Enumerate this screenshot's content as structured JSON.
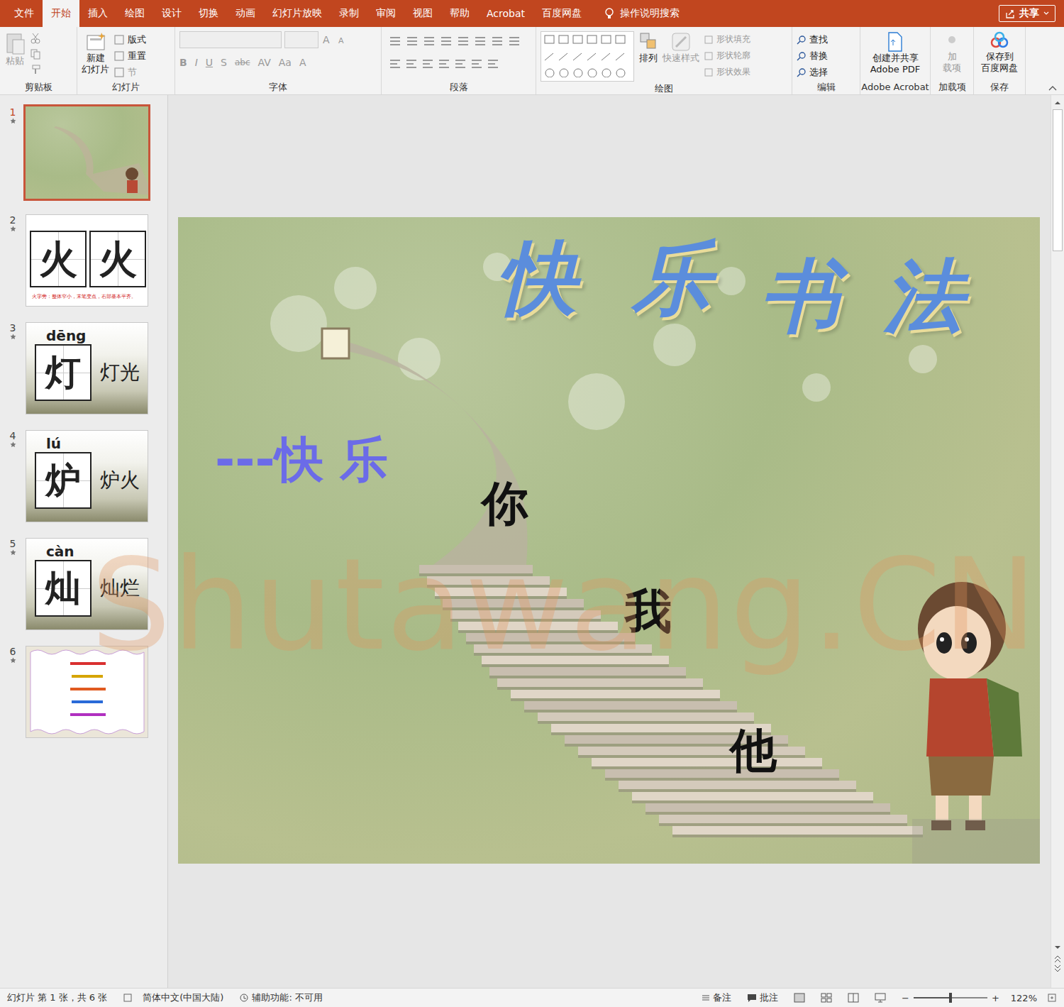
{
  "tabs": [
    {
      "label": "文件",
      "selected": false
    },
    {
      "label": "开始",
      "selected": true
    },
    {
      "label": "插入",
      "selected": false
    },
    {
      "label": "绘图",
      "selected": false
    },
    {
      "label": "设计",
      "selected": false
    },
    {
      "label": "切换",
      "selected": false
    },
    {
      "label": "动画",
      "selected": false
    },
    {
      "label": "幻灯片放映",
      "selected": false
    },
    {
      "label": "录制",
      "selected": false
    },
    {
      "label": "审阅",
      "selected": false
    },
    {
      "label": "视图",
      "selected": false
    },
    {
      "label": "帮助",
      "selected": false
    },
    {
      "label": "Acrobat",
      "selected": false
    },
    {
      "label": "百度网盘",
      "selected": false
    }
  ],
  "tell_me": "操作说明搜索",
  "share": "共享",
  "ribbon": {
    "clipboard": {
      "label": "剪贴板",
      "paste": {
        "label": "粘贴",
        "disabled": true
      }
    },
    "slides": {
      "label": "幻灯片",
      "new_slide": [
        "新建",
        "幻灯片"
      ],
      "layout": "版式",
      "reset": "重置",
      "section": {
        "label": "节",
        "disabled": true
      }
    },
    "font": {
      "label": "字体",
      "buttons": [
        "B",
        "I",
        "U",
        "S",
        "abc",
        "AV",
        "Aa",
        "A"
      ],
      "disabled": true
    },
    "paragraph": {
      "label": "段落"
    },
    "drawing": {
      "label": "绘图",
      "arrange": "排列",
      "quick_styles": {
        "label": "快速样式",
        "disabled": true
      },
      "shape_items": [
        {
          "label": "形状填充",
          "disabled": true
        },
        {
          "label": "形状轮廓",
          "disabled": true
        },
        {
          "label": "形状效果",
          "disabled": true
        }
      ]
    },
    "editing": {
      "label": "编辑",
      "items": [
        "查找",
        "替换",
        "选择"
      ]
    },
    "acrobat": {
      "label": "Adobe Acrobat",
      "button": [
        "创建并共享",
        "Adobe PDF"
      ]
    },
    "addins": {
      "label": "加载项",
      "button": [
        "加",
        "载项"
      ],
      "disabled": true
    },
    "save": {
      "label": "保存",
      "button": [
        "保存到",
        "百度网盘"
      ]
    }
  },
  "thumbnails": [
    {
      "number": "1",
      "selected": true,
      "kind": "cover"
    },
    {
      "number": "2",
      "selected": false,
      "kind": "compare",
      "chars": [
        "火",
        "火"
      ],
      "note": "火字旁：整体窄小，末笔变点，右部基本平齐。"
    },
    {
      "number": "3",
      "selected": false,
      "kind": "word",
      "pinyin": "dēng",
      "char": "灯",
      "word": "灯光"
    },
    {
      "number": "4",
      "selected": false,
      "kind": "word",
      "pinyin": "lú",
      "char": "炉",
      "word": "炉火"
    },
    {
      "number": "5",
      "selected": false,
      "kind": "word",
      "pinyin": "càn",
      "char": "灿",
      "word": "灿烂"
    },
    {
      "number": "6",
      "selected": false,
      "kind": "poem"
    }
  ],
  "slide": {
    "title": [
      "快",
      "乐",
      "书",
      "法"
    ],
    "subtitle": "---快 乐",
    "words": [
      "你",
      "我",
      "他"
    ]
  },
  "watermark": "Shutawang.CN",
  "status_bar": {
    "slide_info": "幻灯片 第 1 张，共 6 张",
    "language": "简体中文(中国大陆)",
    "accessibility": "辅助功能: 不可用",
    "notes": "备注",
    "comments": "批注",
    "zoom_minus": "−",
    "zoom_plus": "+",
    "zoom": "122%",
    "zoom_level": 0.5
  }
}
